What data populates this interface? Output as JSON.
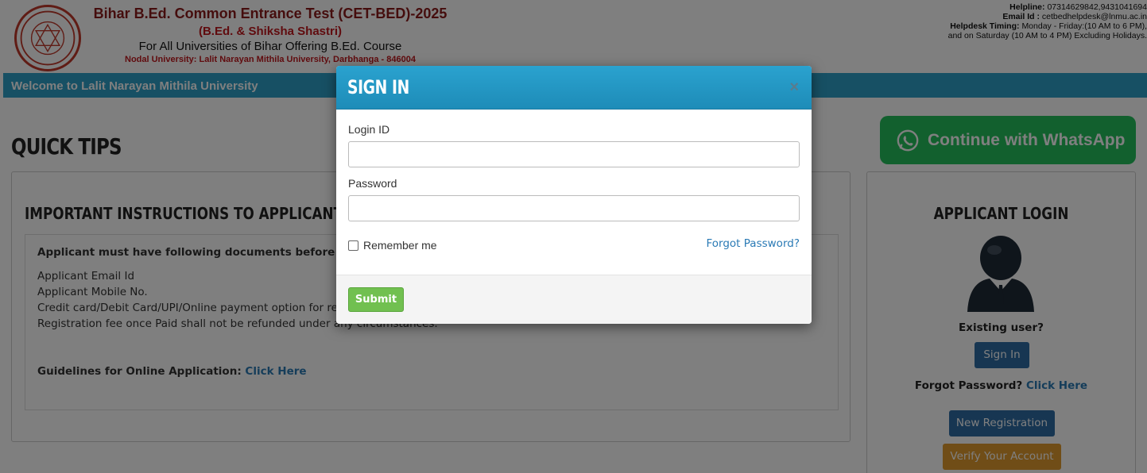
{
  "header": {
    "title_main": "Bihar B.Ed. Common Entrance Test (CET-BED)-2025",
    "title_sub": "(B.Ed. & Shiksha Shastri)",
    "title_for": "For All Universities of Bihar Offering B.Ed. Course",
    "title_nodal": "Nodal University: Lalit Narayan Mithila University, Darbhanga - 846004",
    "helpline_label": "Helpline:",
    "helpline_value": "07314629842,9431041694",
    "email_label": "Email Id :",
    "email_value": "cetbedhelpdesk@lnmu.ac.in",
    "timing_label": "Helpdesk Timing:",
    "timing_value": "Monday - Friday:(10 AM to 6 PM),",
    "timing_value2": "and on Saturday (10 AM to 4 PM) Excluding Holidays."
  },
  "welcome_bar": "Welcome to Lalit Narayan Mithila University",
  "quick_tips": "QUICK TIPS",
  "instructions": {
    "heading": "IMPORTANT INSTRUCTIONS TO APPLICANT BEFORE REGIS",
    "required_docs_title": "Applicant must have following documents before registering",
    "docs": [
      "Applicant Email Id",
      "Applicant Mobile No.",
      "Credit card/Debit Card/UPI/Online payment option for regis",
      "Registration fee once Paid shall not be refunded under any circumstances."
    ],
    "guidelines_label": "Guidelines for Online Application:",
    "guidelines_link": "Click Here"
  },
  "whatsapp": {
    "label": "Continue with WhatsApp",
    "color": "#25c05d"
  },
  "login_panel": {
    "title": "APPLICANT LOGIN",
    "existing_user": "Existing user?",
    "signin_label": "Sign In",
    "forgot_label": "Forgot Password?",
    "forgot_link": "Click Here",
    "new_registration": "New Registration",
    "verify_account": "Verify Your Account"
  },
  "modal": {
    "title": "SIGN IN",
    "close": "×",
    "login_id_label": "Login ID",
    "login_id_value": "",
    "password_label": "Password",
    "password_value": "",
    "remember_me": "Remember me",
    "remember_checked": false,
    "forgot_password": "Forgot Password?",
    "submit": "Submit",
    "header_color": "#2aa2cf",
    "submit_color": "#71c050"
  }
}
